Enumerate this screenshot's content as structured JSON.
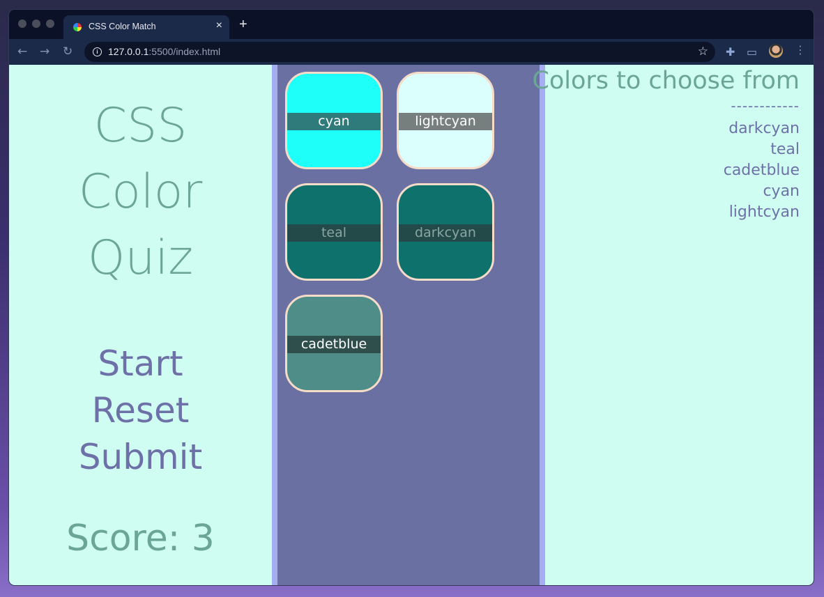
{
  "browser": {
    "tab_title": "CSS Color Match",
    "tab_close": "×",
    "new_tab": "+",
    "url_host": "127.0.0.1",
    "url_rest": ":5500/index.html"
  },
  "quiz": {
    "title_lines": [
      "CSS",
      "Color",
      "Quiz"
    ],
    "menu": {
      "start": "Start",
      "reset": "Reset",
      "submit": "Submit"
    },
    "score": "Score: 3"
  },
  "cards": [
    {
      "label": "cyan",
      "color": "#1ffffa",
      "label_bg": "#2f7a7a",
      "label_color": "#ffffff"
    },
    {
      "label": "lightcyan",
      "color": "#dbfffd",
      "label_bg": "#767f7d",
      "label_color": "#ffffff"
    },
    {
      "label": "teal",
      "color": "#0f716c",
      "label_bg": "#234a48",
      "label_color": "#8aa6a3"
    },
    {
      "label": "darkcyan",
      "color": "#0f716c",
      "label_bg": "#234a48",
      "label_color": "#8aa6a3"
    },
    {
      "label": "cadetblue",
      "color": "#4f8d89",
      "label_bg": "#2f4f4d",
      "label_color": "#ffffff"
    }
  ],
  "choices_panel": {
    "title": "Colors to choose from",
    "divider": "------------",
    "items": [
      "darkcyan",
      "teal",
      "cadetblue",
      "cyan",
      "lightcyan"
    ]
  }
}
